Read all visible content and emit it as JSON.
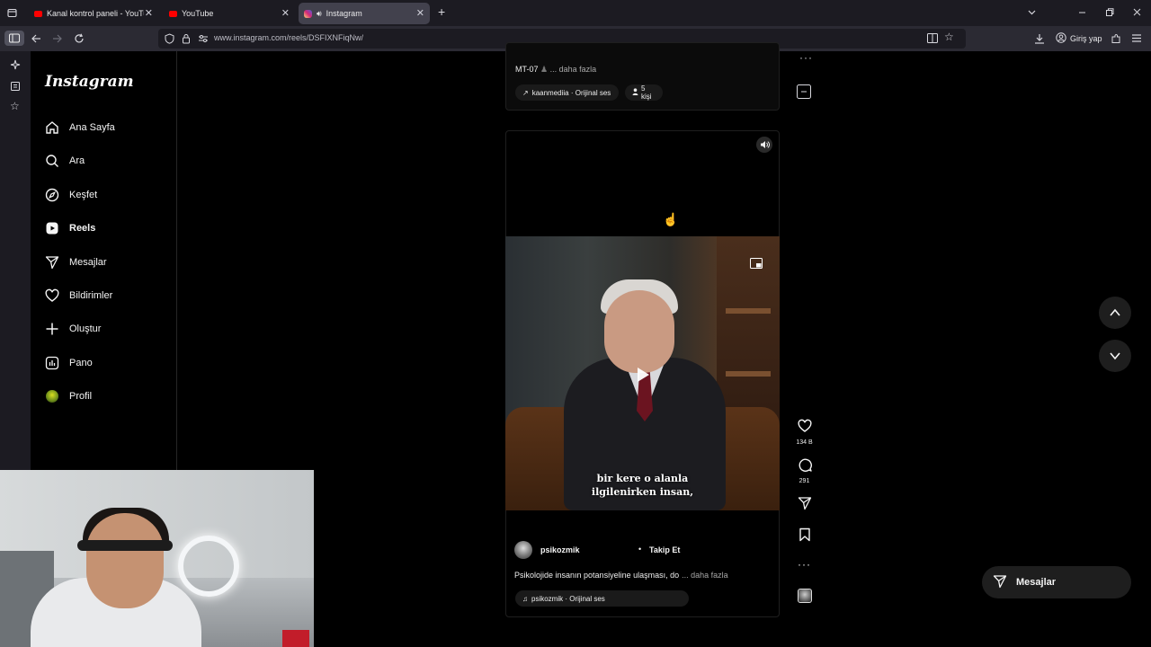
{
  "browser": {
    "tabs": [
      {
        "title": "Kanal kontrol paneli - YouTube S",
        "favicon_color": "#ff0000"
      },
      {
        "title": "YouTube",
        "favicon_color": "#ff0000"
      },
      {
        "title": "Instagram",
        "favicon_color": "#d62976"
      }
    ],
    "url": "www.instagram.com/reels/DSFIXNFiqNw/",
    "signin_label": "Giriş yap"
  },
  "instagram": {
    "logo": "Instagram",
    "nav": [
      {
        "label": "Ana Sayfa",
        "icon": "home-icon"
      },
      {
        "label": "Ara",
        "icon": "search-icon"
      },
      {
        "label": "Keşfet",
        "icon": "compass-icon"
      },
      {
        "label": "Reels",
        "icon": "reels-icon"
      },
      {
        "label": "Mesajlar",
        "icon": "send-icon"
      },
      {
        "label": "Bildirimler",
        "icon": "heart-icon"
      },
      {
        "label": "Oluştur",
        "icon": "plus-icon"
      },
      {
        "label": "Pano",
        "icon": "dashboard-icon"
      },
      {
        "label": "Profil",
        "icon": "profile-avatar"
      }
    ],
    "prev_reel": {
      "caption": "MT-07",
      "more": "... daha fazla",
      "audio": "kaanmediia · Orijinal ses",
      "people": "5 kişi"
    },
    "reel": {
      "subtitle_line1": "bir kere o alanla",
      "subtitle_line2": "ilgilenirken insan,",
      "username": "psikozmik",
      "follow": "Takip Et",
      "caption": "Psikolojide insanın potansiyeline ulaşması, do",
      "more": "... daha fazla",
      "audio": "psikozmik · Orijinal ses",
      "likes": "134 B",
      "comments": "291"
    },
    "messages_button": "Mesajlar"
  }
}
